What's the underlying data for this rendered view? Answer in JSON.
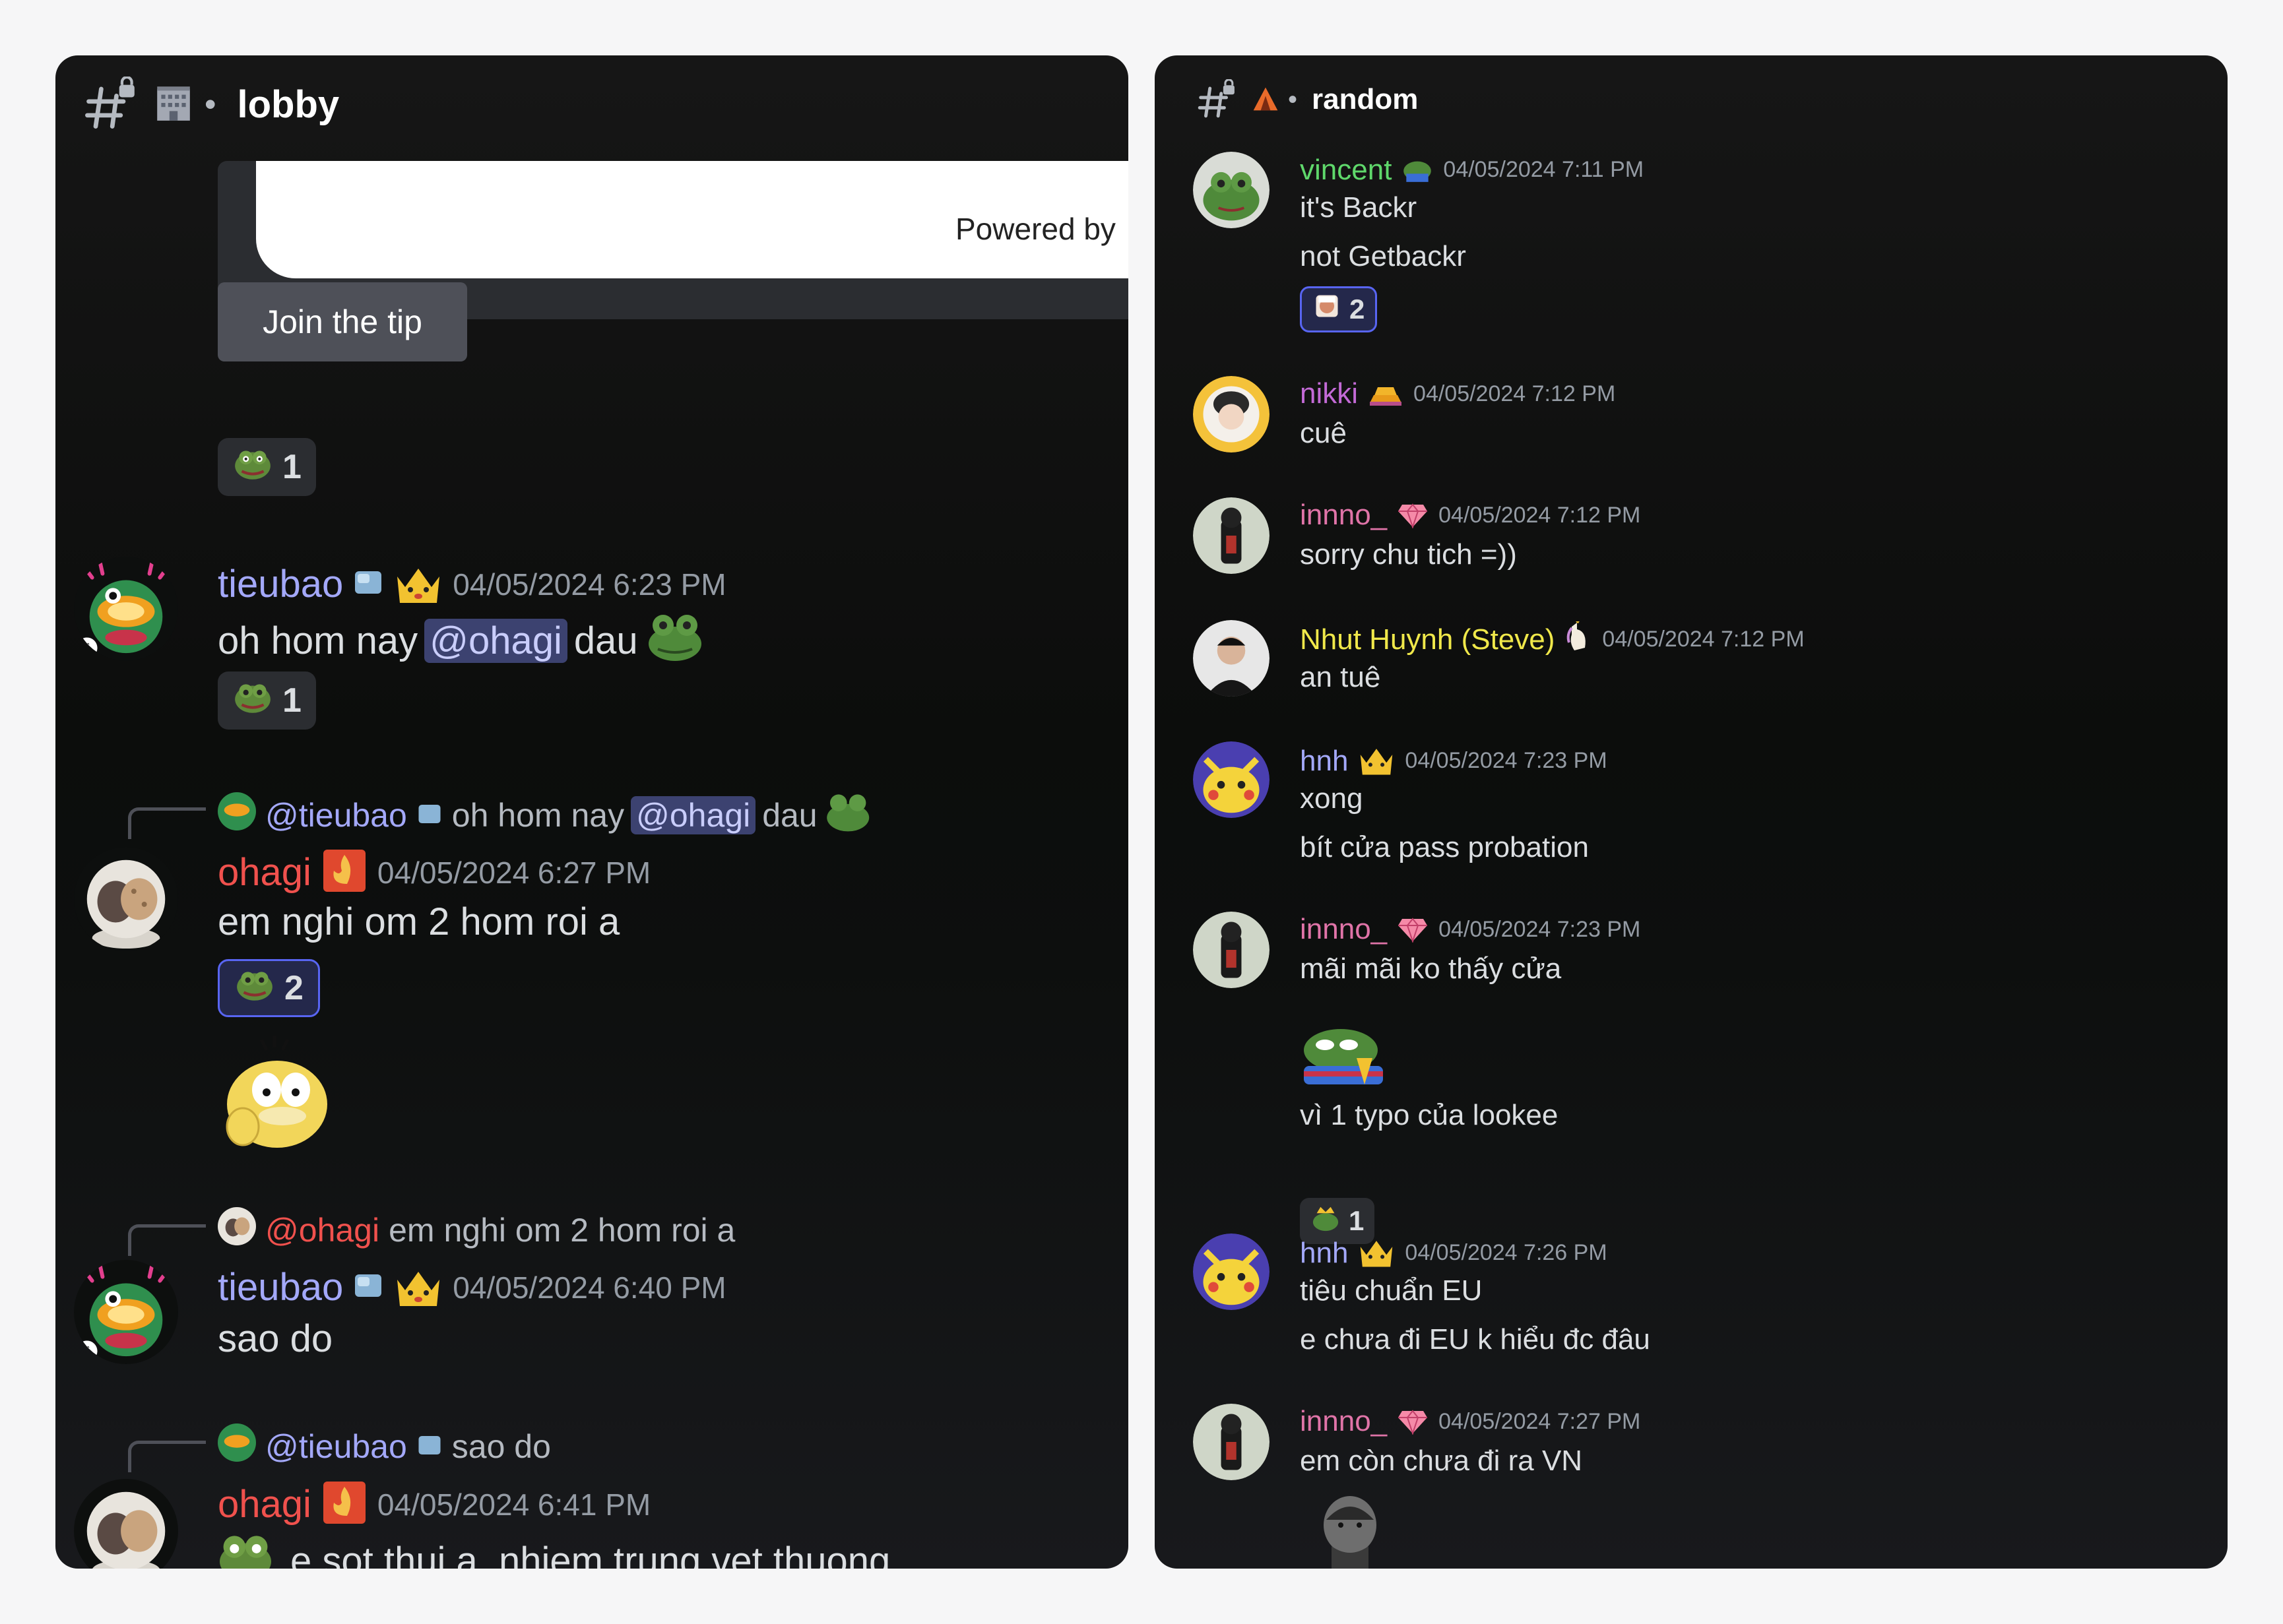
{
  "left": {
    "channel": {
      "icon": "building-icon",
      "name": "lobby"
    },
    "embed": {
      "powered_by": "Powered by"
    },
    "join_button": "Join the tip",
    "reaction_0": {
      "icon": "pepe-icon",
      "count": "1"
    },
    "messages": [
      {
        "author": "tieubao",
        "author_color": "#a3a8f9",
        "timestamp": "04/05/2024 6:23 PM",
        "text_before": "oh hom nay",
        "mention": "@ohagi",
        "text_after": "dau",
        "reaction": {
          "icon": "pepe-icon",
          "count": "1"
        }
      },
      {
        "reply_to": "@tieubao",
        "reply_text_before": "oh hom nay",
        "reply_mention": "@ohagi",
        "reply_text_after": "dau",
        "author": "ohagi",
        "author_color": "#f0514d",
        "timestamp": "04/05/2024 6:27 PM",
        "text": "em nghi om 2 hom roi a",
        "reaction": {
          "icon": "pepe-icon",
          "count": "2"
        },
        "sticker": "psyduck-sticker"
      },
      {
        "reply_to": "@ohagi",
        "reply_text": "em nghi om 2 hom roi a",
        "author": "tieubao",
        "author_color": "#a3a8f9",
        "timestamp": "04/05/2024 6:40 PM",
        "text": "sao do"
      },
      {
        "reply_to": "@tieubao",
        "reply_text": "sao do",
        "author": "ohagi",
        "author_color": "#f0514d",
        "timestamp": "04/05/2024 6:41 PM",
        "text": "e sot thui a, nhiem trung vet thuong"
      }
    ]
  },
  "right": {
    "channel": {
      "icon": "tent-icon",
      "name": "random"
    },
    "messages": [
      {
        "author": "vincent",
        "author_color": "#5fd86b",
        "timestamp": "04/05/2024 7:11 PM",
        "lines": [
          "it's Backr",
          "not Getbackr"
        ],
        "reaction": {
          "count": "2"
        }
      },
      {
        "author": "nikki",
        "author_color": "#c36ad6",
        "timestamp": "04/05/2024 7:12 PM",
        "lines": [
          "cuê"
        ]
      },
      {
        "author": "innno_",
        "author_color": "#e074a8",
        "timestamp": "04/05/2024 7:12 PM",
        "lines": [
          "sorry chu tich =))"
        ]
      },
      {
        "author": "Nhut Huynh (Steve)",
        "author_color": "#f0e84a",
        "timestamp": "04/05/2024 7:12 PM",
        "lines": [
          "an tuê"
        ]
      },
      {
        "author": "hnh",
        "author_color": "#a3a8f9",
        "timestamp": "04/05/2024 7:23 PM",
        "lines": [
          "xong",
          "bít cửa pass probation"
        ]
      },
      {
        "author": "innno_",
        "author_color": "#e074a8",
        "timestamp": "04/05/2024 7:23 PM",
        "lines": [
          "mãi mãi ko thấy cửa",
          "vì 1 typo của lookee"
        ],
        "reaction": {
          "count": "1"
        }
      },
      {
        "author": "hnh",
        "author_color": "#a3a8f9",
        "timestamp": "04/05/2024 7:26 PM",
        "lines": [
          "tiêu chuẩn EU",
          "e chưa đi EU k hiểu đc đâu"
        ]
      },
      {
        "author": "innno_",
        "author_color": "#e074a8",
        "timestamp": "04/05/2024 7:27 PM",
        "lines": [
          "em còn chưa đi ra VN"
        ]
      }
    ]
  }
}
